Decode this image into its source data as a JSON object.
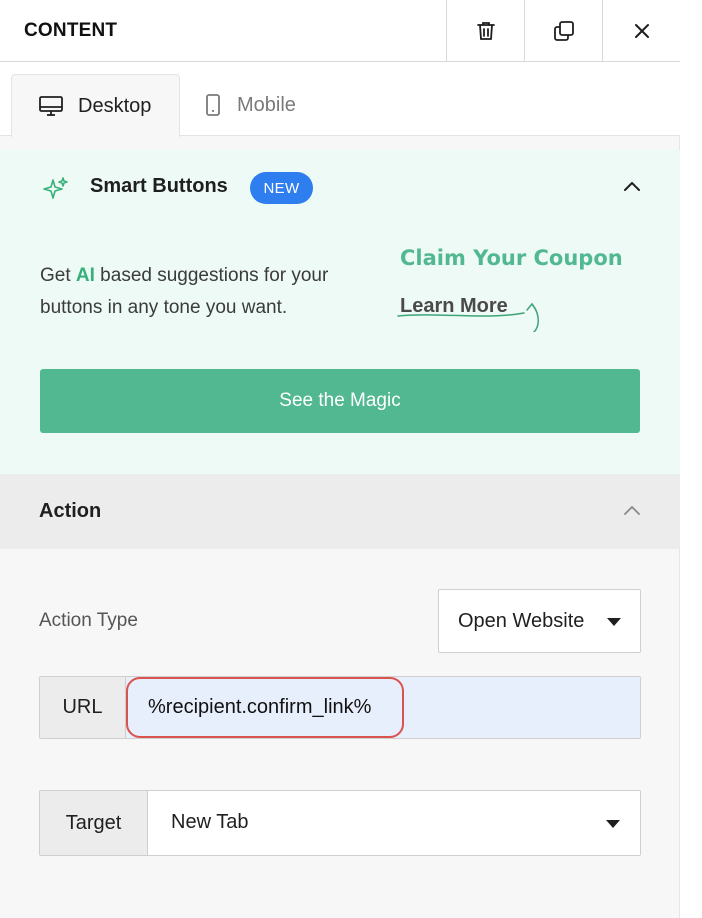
{
  "header": {
    "title": "CONTENT",
    "icons": [
      "trash-icon",
      "duplicate-icon",
      "close-icon"
    ]
  },
  "tabs": [
    {
      "label": "Desktop",
      "icon": "desktop-icon",
      "active": true
    },
    {
      "label": "Mobile",
      "icon": "mobile-icon",
      "active": false
    }
  ],
  "smart_buttons": {
    "title": "Smart Buttons",
    "badge": "NEW",
    "description_pre": "Get ",
    "description_highlight": "AI",
    "description_post": " based suggestions for your buttons in any tone you want.",
    "example_primary": "Claim Your Coupon",
    "example_secondary": "Learn More",
    "cta": "See the Magic"
  },
  "action": {
    "title": "Action",
    "type_label": "Action Type",
    "type_value": "Open Website",
    "url_label": "URL",
    "url_value": "%recipient.confirm_link%",
    "target_label": "Target",
    "target_value": "New Tab"
  },
  "colors": {
    "accent_green": "#52b891",
    "badge_blue": "#2f7ef0",
    "highlight_red": "#d9534f"
  }
}
